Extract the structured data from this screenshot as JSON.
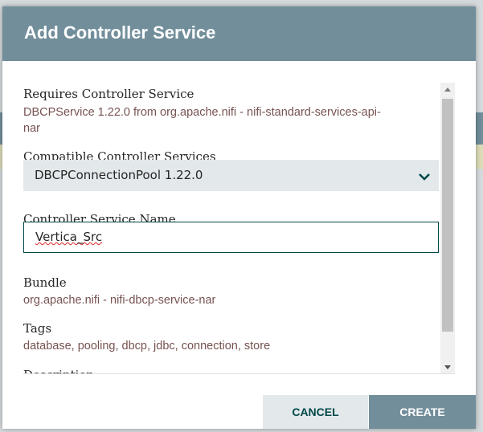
{
  "dialog": {
    "title": "Add Controller Service"
  },
  "requires": {
    "label": "Requires Controller Service",
    "value_line1": "DBCPService 1.22.0 from org.apache.nifi - nifi-standard-services-api-",
    "value_line2": "nar"
  },
  "compatible": {
    "label": "Compatible Controller Services",
    "selected": "DBCPConnectionPool 1.22.0"
  },
  "name_field": {
    "label": "Controller Service Name",
    "value": "Vertica_Src"
  },
  "bundle": {
    "label": "Bundle",
    "value": "org.apache.nifi - nifi-dbcp-service-nar"
  },
  "tags": {
    "label": "Tags",
    "value": "database, pooling, dbcp, jdbc, connection, store"
  },
  "description": {
    "label": "Description"
  },
  "buttons": {
    "cancel": "CANCEL",
    "create": "CREATE"
  },
  "colors": {
    "header": "#728e9b",
    "value_text": "#775351",
    "accent": "#004849"
  }
}
